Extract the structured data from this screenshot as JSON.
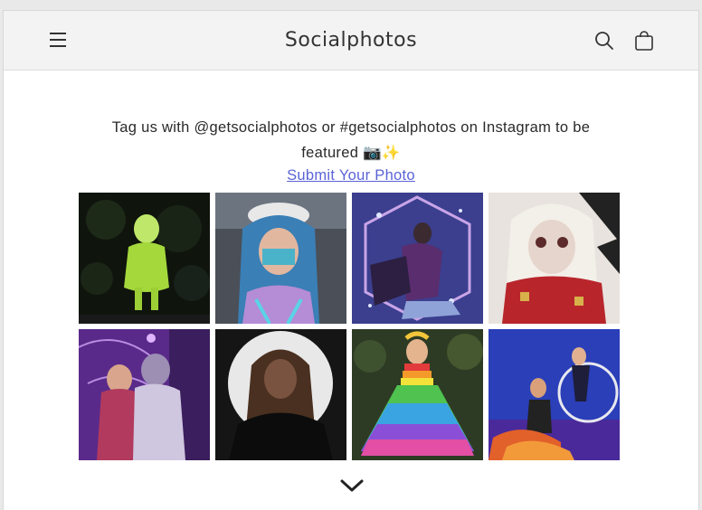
{
  "header": {
    "brand": "Socialphotos",
    "icons": {
      "menu": "hamburger-menu-icon",
      "search": "search-icon",
      "cart": "shopping-bag-icon"
    }
  },
  "intro": {
    "line1": "Tag us with @getsocialphotos or #getsocialphotos on Instagram to be",
    "line2": "featured 📷✨"
  },
  "submit_link": "Submit Your Photo",
  "gallery": [
    {
      "name": "photo-green-costume"
    },
    {
      "name": "photo-blue-hair-rave"
    },
    {
      "name": "photo-sequin-dancer"
    },
    {
      "name": "photo-white-hair-makeup"
    },
    {
      "name": "photo-purple-couple"
    },
    {
      "name": "photo-spotlight-portrait"
    },
    {
      "name": "photo-rainbow-dress"
    },
    {
      "name": "photo-hoop-performers"
    }
  ],
  "colors": {
    "link": "#5a63d6",
    "header_bg": "#f3f3f3",
    "text": "#2a2a2a"
  },
  "more_icon": "chevron-down-icon"
}
